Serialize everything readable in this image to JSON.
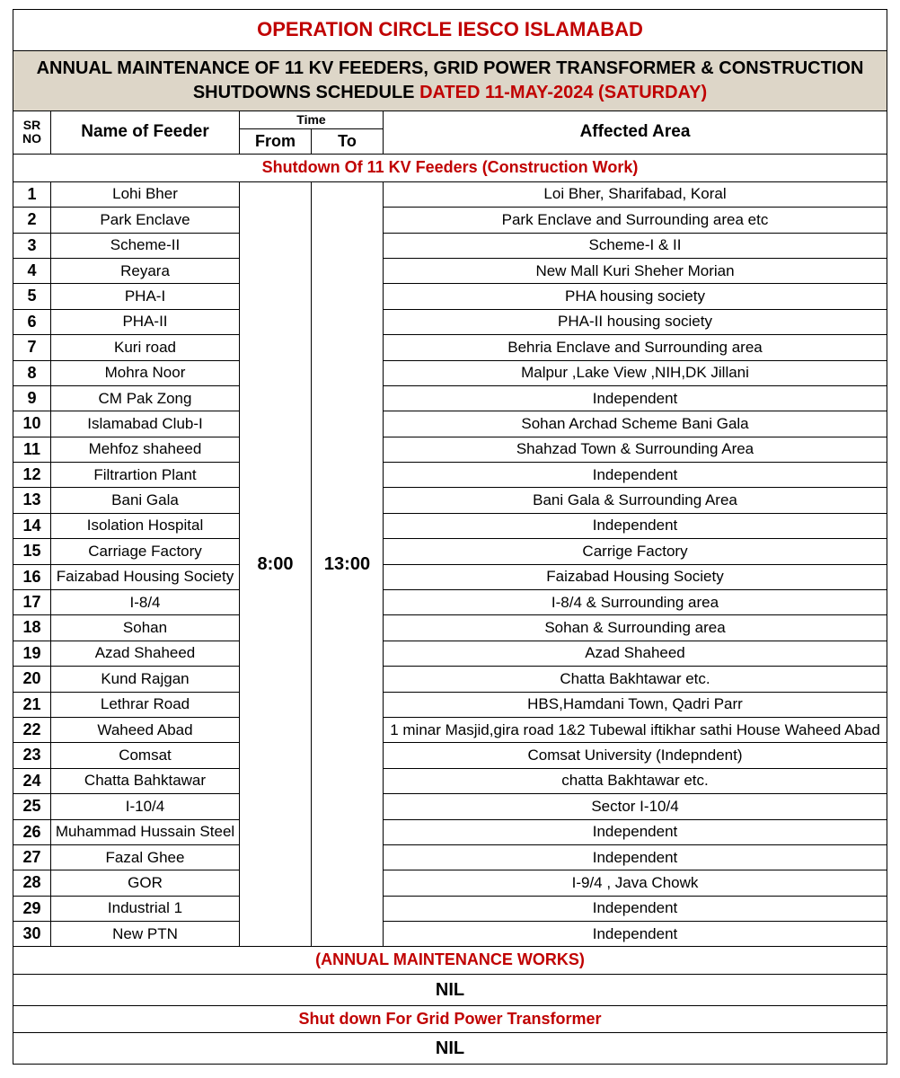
{
  "title": "OPERATION CIRCLE IESCO ISLAMABAD",
  "subtitle_black": "ANNUAL MAINTENANCE OF 11 KV FEEDERS, GRID POWER TRANSFORMER & CONSTRUCTION SHUTDOWNS SCHEDULE ",
  "subtitle_red": "DATED 11-MAY-2024 (SATURDAY)",
  "headers": {
    "sr": "SR NO",
    "feeder": "Name of Feeder",
    "time": "Time",
    "from": "From",
    "to": "To",
    "area": "Affected Area"
  },
  "section1": "Shutdown Of 11 KV Feeders (Construction Work)",
  "time_from": "8:00",
  "time_to": "13:00",
  "rows": [
    {
      "sr": "1",
      "feeder": "Lohi Bher",
      "area": "Loi Bher, Sharifabad, Koral"
    },
    {
      "sr": "2",
      "feeder": "Park Enclave",
      "area": "Park Enclave and Surrounding area etc"
    },
    {
      "sr": "3",
      "feeder": "Scheme-II",
      "area": "Scheme-I & II"
    },
    {
      "sr": "4",
      "feeder": "Reyara",
      "area": "New Mall Kuri Sheher Morian"
    },
    {
      "sr": "5",
      "feeder": "PHA-I",
      "area": "PHA housing society"
    },
    {
      "sr": "6",
      "feeder": "PHA-II",
      "area": "PHA-II housing society"
    },
    {
      "sr": "7",
      "feeder": "Kuri road",
      "area": "Behria Enclave and Surrounding area"
    },
    {
      "sr": "8",
      "feeder": "Mohra Noor",
      "area": "Malpur ,Lake View ,NIH,DK Jillani"
    },
    {
      "sr": "9",
      "feeder": "CM Pak Zong",
      "area": "Independent"
    },
    {
      "sr": "10",
      "feeder": "Islamabad Club-I",
      "area": "Sohan Archad Scheme Bani Gala"
    },
    {
      "sr": "11",
      "feeder": "Mehfoz  shaheed",
      "area": "Shahzad Town & Surrounding Area"
    },
    {
      "sr": "12",
      "feeder": "Filtrartion Plant",
      "area": "Independent"
    },
    {
      "sr": "13",
      "feeder": "Bani Gala",
      "area": "Bani Gala & Surrounding Area"
    },
    {
      "sr": "14",
      "feeder": "Isolation Hospital",
      "area": "Independent"
    },
    {
      "sr": "15",
      "feeder": "Carriage Factory",
      "area": "Carrige Factory"
    },
    {
      "sr": "16",
      "feeder": "Faizabad Housing Society",
      "area": "Faizabad Housing Society"
    },
    {
      "sr": "17",
      "feeder": "I-8/4",
      "area": "I-8/4 & Surrounding area"
    },
    {
      "sr": "18",
      "feeder": "Sohan",
      "area": "Sohan & Surrounding area"
    },
    {
      "sr": "19",
      "feeder": "Azad Shaheed",
      "area": "Azad Shaheed"
    },
    {
      "sr": "20",
      "feeder": "Kund Rajgan",
      "area": "Chatta Bakhtawar etc."
    },
    {
      "sr": "21",
      "feeder": "Lethrar Road",
      "area": "HBS,Hamdani Town, Qadri Parr"
    },
    {
      "sr": "22",
      "feeder": "Waheed Abad",
      "area": "1 minar Masjid,gira road 1&2 Tubewal iftikhar sathi House Waheed Abad"
    },
    {
      "sr": "23",
      "feeder": "Comsat",
      "area": "Comsat University (Indepndent)"
    },
    {
      "sr": "24",
      "feeder": "Chatta Bahktawar",
      "area": "chatta Bakhtawar etc."
    },
    {
      "sr": "25",
      "feeder": "I-10/4",
      "area": "Sector I-10/4"
    },
    {
      "sr": "26",
      "feeder": "Muhammad Hussain Steel",
      "area": "Independent"
    },
    {
      "sr": "27",
      "feeder": "Fazal Ghee",
      "area": "Independent"
    },
    {
      "sr": "28",
      "feeder": "GOR",
      "area": "I-9/4 , Java Chowk"
    },
    {
      "sr": "29",
      "feeder": "Industrial 1",
      "area": "Independent"
    },
    {
      "sr": "30",
      "feeder": "New PTN",
      "area": "Independent"
    }
  ],
  "section2": "(ANNUAL MAINTENANCE WORKS)",
  "nil1": "NIL",
  "section3": "Shut down For Grid Power Transformer",
  "nil2": "NIL"
}
